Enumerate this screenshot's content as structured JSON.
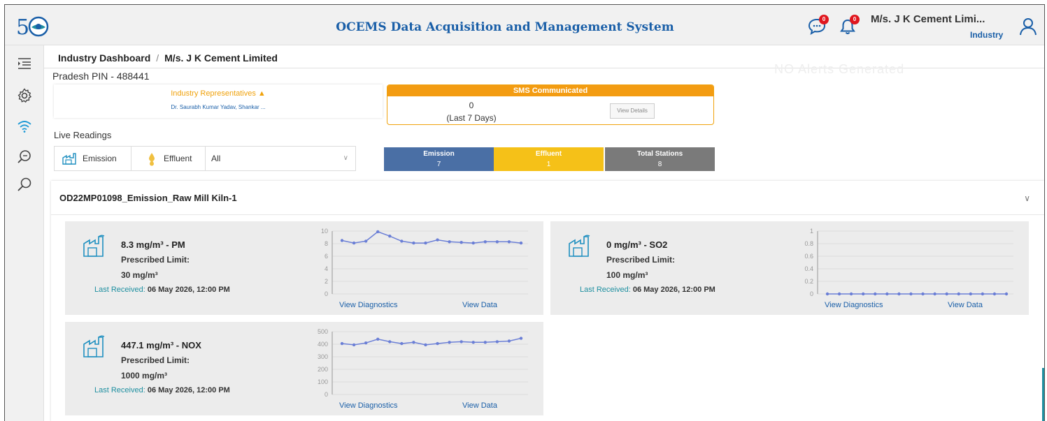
{
  "header": {
    "title": "OCEMS Data Acquisition and Management System",
    "chat_badge": "0",
    "bell_badge": "0",
    "user_name": "M/s. J K Cement Limi...",
    "user_role": "Industry"
  },
  "breadcrumb": {
    "root": "Industry Dashboard",
    "separator": "/",
    "current": "M/s. J K Cement Limited"
  },
  "pin_text": "Pradesh PIN - 488441",
  "faint_text": "NO Alerts Generated",
  "representatives": {
    "title": "Industry Representatives ▲",
    "names": "Dr. Saurabh Kumar Yadav, Shankar ..."
  },
  "sms": {
    "title": "SMS Communicated",
    "count": "0",
    "period": "(Last 7 Days)",
    "button": "View Details"
  },
  "live_label": "Live Readings",
  "filter": {
    "emission": "Emission",
    "effluent": "Effluent",
    "select_value": "All"
  },
  "tiles": [
    {
      "label": "Emission",
      "value": "7",
      "color": "#4a6fa5"
    },
    {
      "label": "Effluent",
      "value": "1",
      "color": "#f5c118"
    },
    {
      "label": "Total Stations",
      "value": "8",
      "color": "#7a7a7a"
    }
  ],
  "station": {
    "title": "OD22MP01098_Emission_Raw Mill Kiln-1"
  },
  "cards": [
    {
      "value_text": "8.3 mg/m³ - PM",
      "prescribed_label": "Prescribed Limit:",
      "limit": "30  mg/m³",
      "last_label": "Last Received:",
      "last_value": "06 May 2026, 12:00 PM",
      "diag": "View Diagnostics",
      "data": "View Data"
    },
    {
      "value_text": "0 mg/m³ - SO2",
      "prescribed_label": "Prescribed Limit:",
      "limit": "100  mg/m³",
      "last_label": "Last Received:",
      "last_value": "06 May 2026, 12:00 PM",
      "diag": "View Diagnostics",
      "data": "View Data"
    },
    {
      "value_text": "447.1 mg/m³ - NOX",
      "prescribed_label": "Prescribed Limit:",
      "limit": "1000  mg/m³",
      "last_label": "Last Received:",
      "last_value": "06 May 2026, 12:00 PM",
      "diag": "View Diagnostics",
      "data": "View Data"
    }
  ],
  "chart_data": [
    {
      "type": "line",
      "ylim": [
        0,
        10
      ],
      "yticks": [
        "10",
        "8",
        "6",
        "4",
        "2",
        "0"
      ],
      "values": [
        8.5,
        8.1,
        8.4,
        9.9,
        9.2,
        8.4,
        8.1,
        8.1,
        8.6,
        8.3,
        8.2,
        8.1,
        8.3,
        8.3,
        8.3,
        8.1
      ]
    },
    {
      "type": "line",
      "ylim": [
        0,
        1
      ],
      "yticks": [
        "1",
        "0.8",
        "0.6",
        "0.4",
        "0.2",
        "0"
      ],
      "values": [
        0,
        0,
        0,
        0,
        0,
        0,
        0,
        0,
        0,
        0,
        0,
        0,
        0,
        0,
        0,
        0
      ]
    },
    {
      "type": "line",
      "ylim": [
        0,
        500
      ],
      "yticks": [
        "500",
        "400",
        "300",
        "200",
        "100",
        "0"
      ],
      "values": [
        405,
        395,
        410,
        440,
        420,
        405,
        415,
        395,
        405,
        415,
        420,
        415,
        415,
        420,
        425,
        447
      ]
    }
  ]
}
